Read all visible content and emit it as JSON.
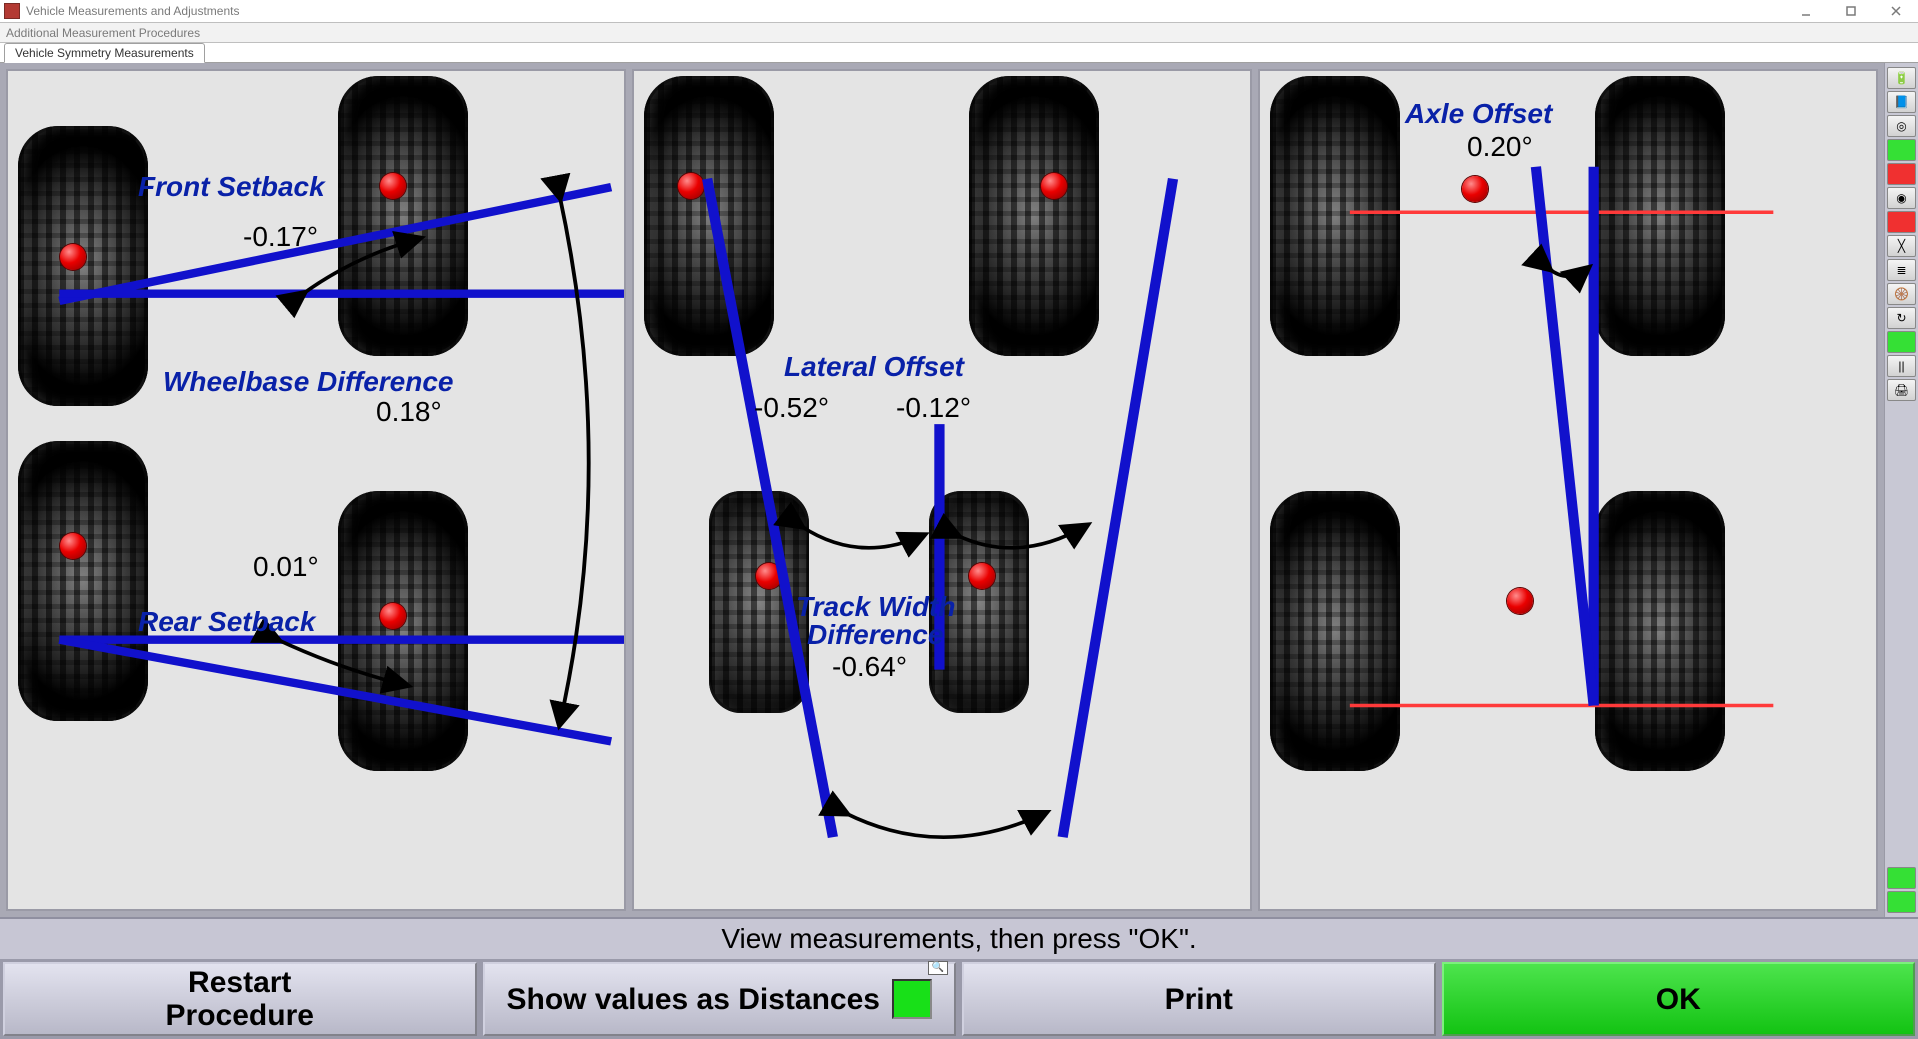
{
  "window": {
    "title": "Vehicle Measurements and Adjustments",
    "menu": "Additional Measurement Procedures",
    "tab": "Vehicle Symmetry Measurements"
  },
  "panels": {
    "left": {
      "front_setback_label": "Front Setback",
      "front_setback_value": "-0.17°",
      "wheelbase_diff_label": "Wheelbase Difference",
      "wheelbase_diff_value": "0.18°",
      "rear_setback_label": "Rear Setback",
      "rear_setback_value": "0.01°"
    },
    "center": {
      "lateral_offset_label": "Lateral Offset",
      "lateral_offset_left_value": "-0.52°",
      "lateral_offset_right_value": "-0.12°",
      "track_width_diff_label_line1": "Track Width",
      "track_width_diff_label_line2": "Difference",
      "track_width_diff_value": "-0.64°"
    },
    "right": {
      "axle_offset_label": "Axle Offset",
      "axle_offset_value": "0.20°"
    }
  },
  "instruction": "View measurements, then press \"OK\".",
  "buttons": {
    "restart": "Restart\nProcedure",
    "show_distances": "Show values as Distances",
    "print": "Print",
    "ok": "OK"
  }
}
